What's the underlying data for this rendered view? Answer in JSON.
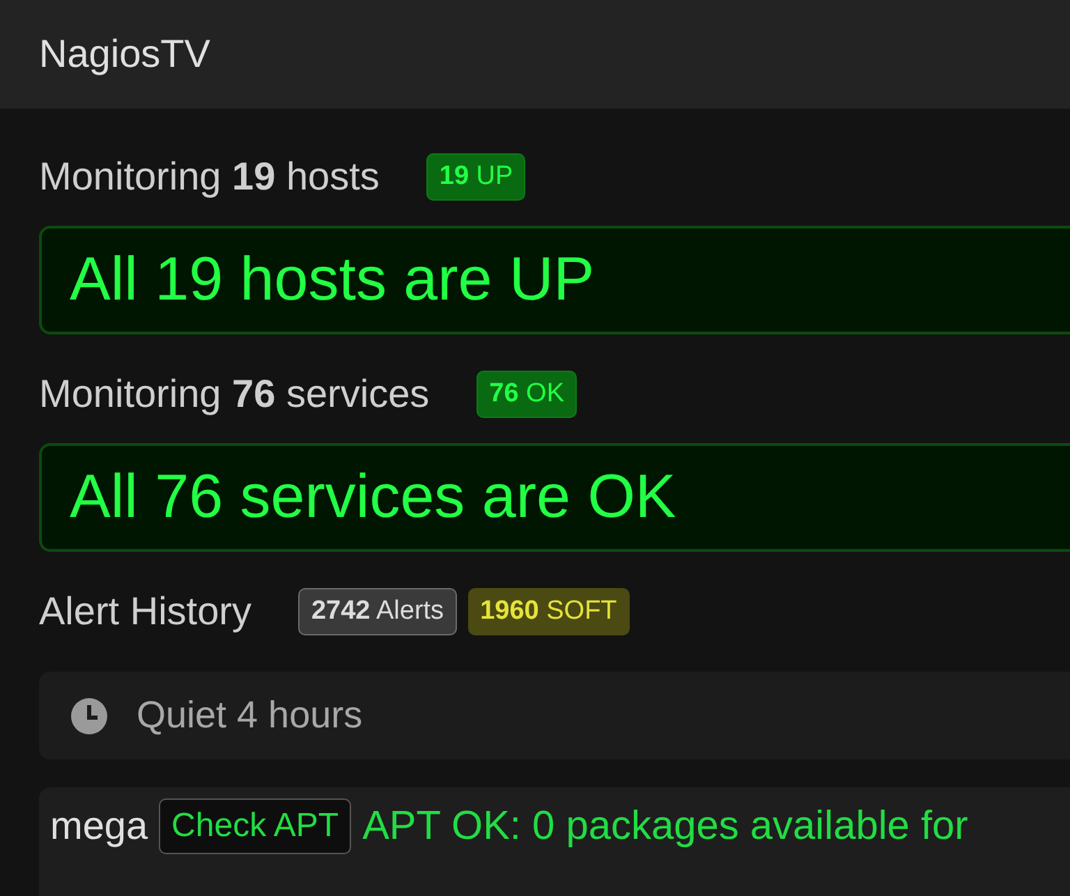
{
  "header": {
    "title": "NagiosTV"
  },
  "hosts": {
    "heading": "Monitoring **19** hosts",
    "badges": [
      {
        "text": "**19** UP",
        "kind": "ok"
      }
    ],
    "summary": "All 19 hosts are UP"
  },
  "services": {
    "heading": "Monitoring **76** services",
    "badges": [
      {
        "text": "**76** OK",
        "kind": "ok"
      }
    ],
    "summary": "All 76 services are OK"
  },
  "alert_history": {
    "heading": "Alert History",
    "badges": [
      {
        "text": "**2742** Alerts",
        "kind": "total"
      },
      {
        "text": "**1960** SOFT",
        "kind": "soft"
      }
    ],
    "quiet": "Quiet 4 hours",
    "alerts": [
      {
        "host": "mega",
        "service": "Check APT",
        "output": "APT OK: 0 packages available for"
      }
    ]
  }
}
